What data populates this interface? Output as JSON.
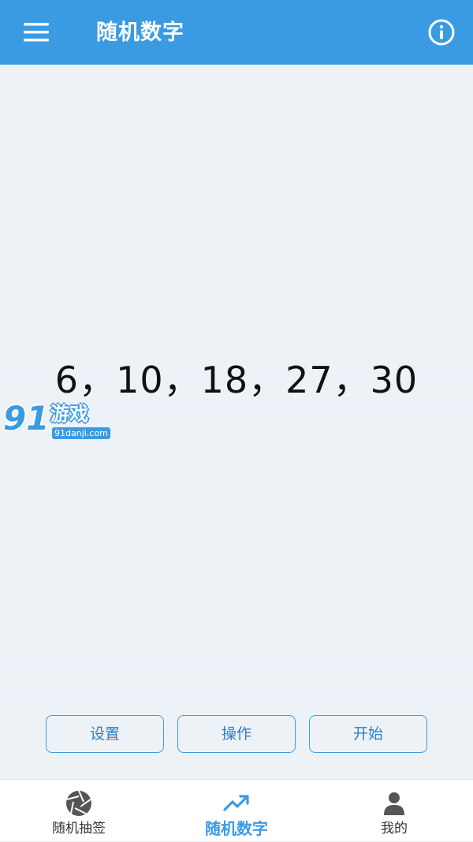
{
  "colors": {
    "primary": "#3a9be3",
    "background": "#edf2f7",
    "nav_inactive": "#555555"
  },
  "header": {
    "title": "随机数字",
    "menu_icon": "menu-icon",
    "info_icon": "info-icon"
  },
  "result": {
    "text": "6，10，18，27，30",
    "numbers": [
      6,
      10,
      18,
      27,
      30
    ]
  },
  "watermark": {
    "digits": "91",
    "name": "游戏",
    "site": "91danji.com"
  },
  "actions": {
    "settings": "设置",
    "operate": "操作",
    "start": "开始"
  },
  "bottom_nav": [
    {
      "label": "随机抽签",
      "icon": "aperture-icon",
      "active": false
    },
    {
      "label": "随机数字",
      "icon": "trending-up-icon",
      "active": true
    },
    {
      "label": "我的",
      "icon": "person-icon",
      "active": false
    }
  ]
}
